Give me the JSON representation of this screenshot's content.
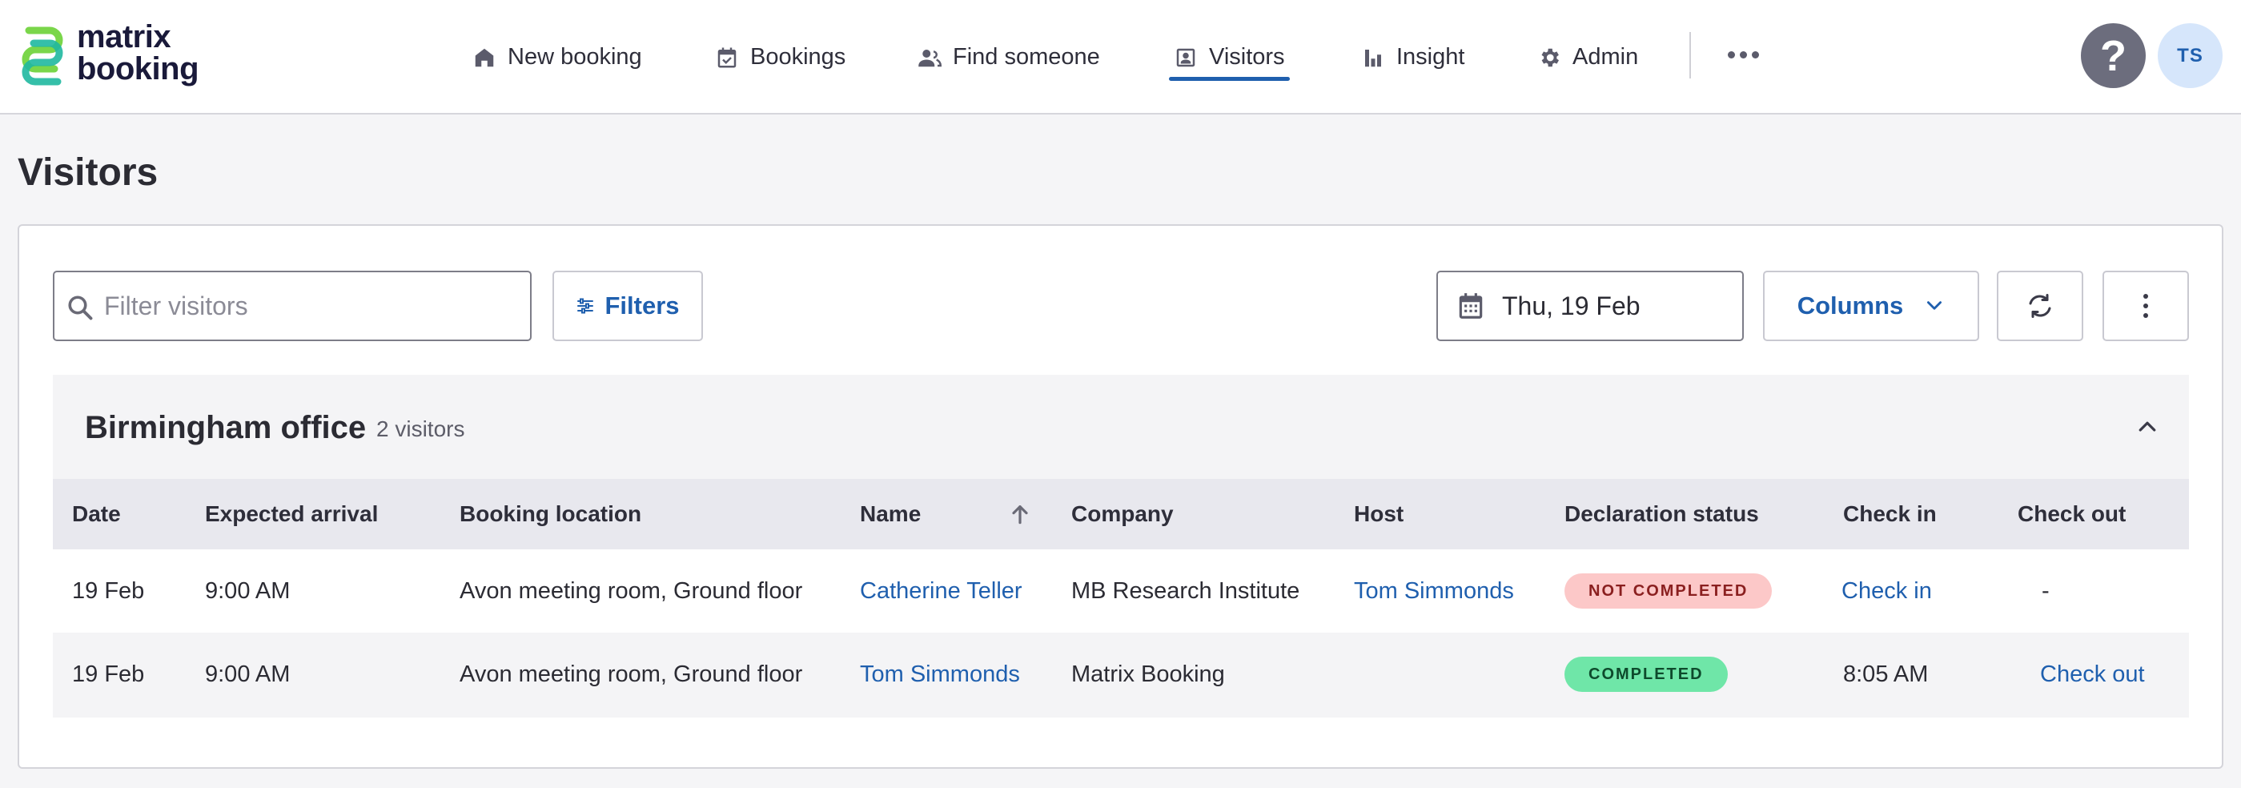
{
  "app": {
    "logo_line1": "matrix",
    "logo_line2": "booking"
  },
  "nav": {
    "items": [
      {
        "label": "New booking",
        "icon": "home-icon"
      },
      {
        "label": "Bookings",
        "icon": "calendar-check-icon"
      },
      {
        "label": "Find someone",
        "icon": "people-icon"
      },
      {
        "label": "Visitors",
        "icon": "visitor-badge-icon",
        "active": true
      },
      {
        "label": "Insight",
        "icon": "bar-chart-icon"
      },
      {
        "label": "Admin",
        "icon": "gear-icon"
      }
    ],
    "help_label": "?",
    "avatar_initials": "TS"
  },
  "page": {
    "title": "Visitors"
  },
  "toolbar": {
    "search_placeholder": "Filter visitors",
    "filters_label": "Filters",
    "date_label": "Thu, 19 Feb",
    "columns_label": "Columns"
  },
  "group": {
    "title": "Birmingham office",
    "count": "2 visitors"
  },
  "table": {
    "headers": [
      "Date",
      "Expected arrival",
      "Booking location",
      "Name",
      "Company",
      "Host",
      "Declaration status",
      "Check in",
      "Check out"
    ],
    "rows": [
      {
        "date": "19 Feb",
        "arrival": "9:00 AM",
        "location": "Avon meeting room, Ground floor",
        "name": "Catherine Teller",
        "company": "MB Research Institute",
        "host": "Tom Simmonds",
        "status": "NOT COMPLETED",
        "check_in": "Check in",
        "check_out": "-"
      },
      {
        "date": "19 Feb",
        "arrival": "9:00 AM",
        "location": "Avon meeting room, Ground floor",
        "name": "Tom Simmonds",
        "company": "Matrix Booking",
        "host": "",
        "status": "COMPLETED",
        "check_in": "8:05 AM",
        "check_out": "Check out"
      }
    ]
  },
  "colors": {
    "accent": "#1f5fae",
    "status_not_completed": "#fcc8c8",
    "status_completed": "#6fe6a8"
  }
}
